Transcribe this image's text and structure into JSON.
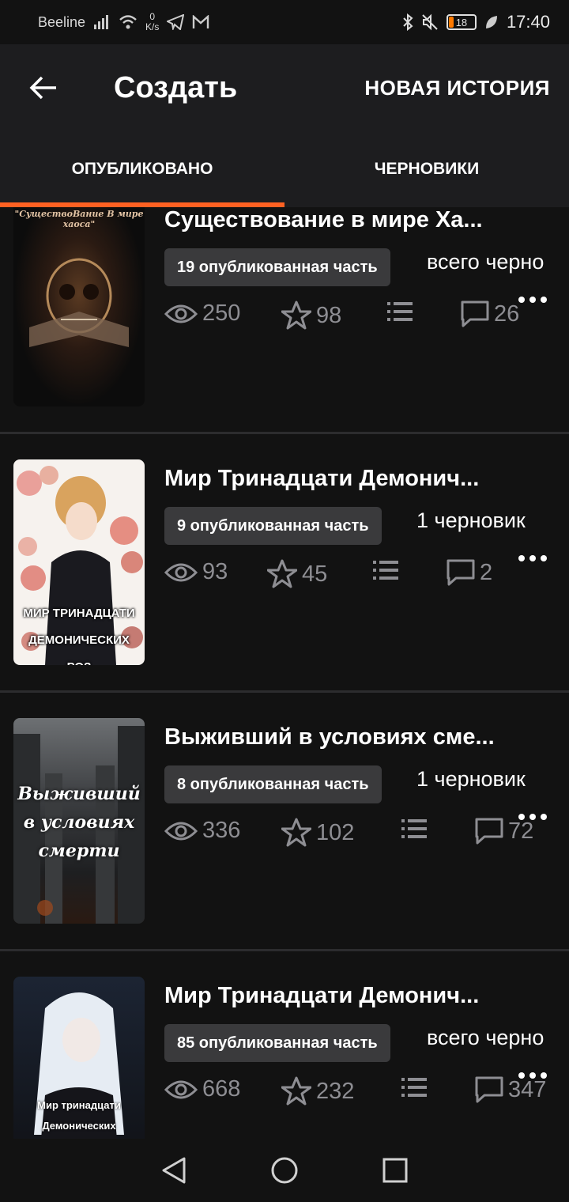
{
  "status_bar": {
    "carrier": "Beeline",
    "net_speed_value": "0",
    "net_speed_unit": "K/s",
    "battery": "18",
    "time": "17:40"
  },
  "app_bar": {
    "back_icon": "arrow-left-icon",
    "title": "Создать",
    "new_story_label": "НОВАЯ ИСТОРИЯ"
  },
  "tabs": [
    {
      "label": "ОПУБЛИКОВАНО",
      "active": true
    },
    {
      "label": "ЧЕРНОВИКИ",
      "active": false
    }
  ],
  "stories": [
    {
      "title": "Существование в мире Ха...",
      "published": "19 опубликованная часть",
      "drafts": "всего черно",
      "views": "250",
      "votes": "98",
      "comments": "26",
      "cover_text": "\"СуществоВание В мире хаоса\""
    },
    {
      "title": "Мир Тринадцати Демонич...",
      "published": "9 опубликованная часть",
      "drafts": "1 черновик",
      "views": "93",
      "votes": "45",
      "comments": "2",
      "cover_text": "МИР ТРИНАДЦАТИ ДЕМОНИЧЕСКИХ РОЗ"
    },
    {
      "title": "Выживший в условиях сме...",
      "published": "8 опубликованная часть",
      "drafts": "1 черновик",
      "views": "336",
      "votes": "102",
      "comments": "72",
      "cover_text": "Выживший в условиях смерти"
    },
    {
      "title": "Мир Тринадцати Демонич...",
      "published": "85 опубликованная часть",
      "drafts": "всего черно",
      "views": "668",
      "votes": "232",
      "comments": "347",
      "cover_text": "Мир тринадцати Демонических"
    }
  ],
  "nav_bar": {
    "back": "triangle-back-icon",
    "home": "circle-home-icon",
    "recents": "square-recents-icon"
  }
}
